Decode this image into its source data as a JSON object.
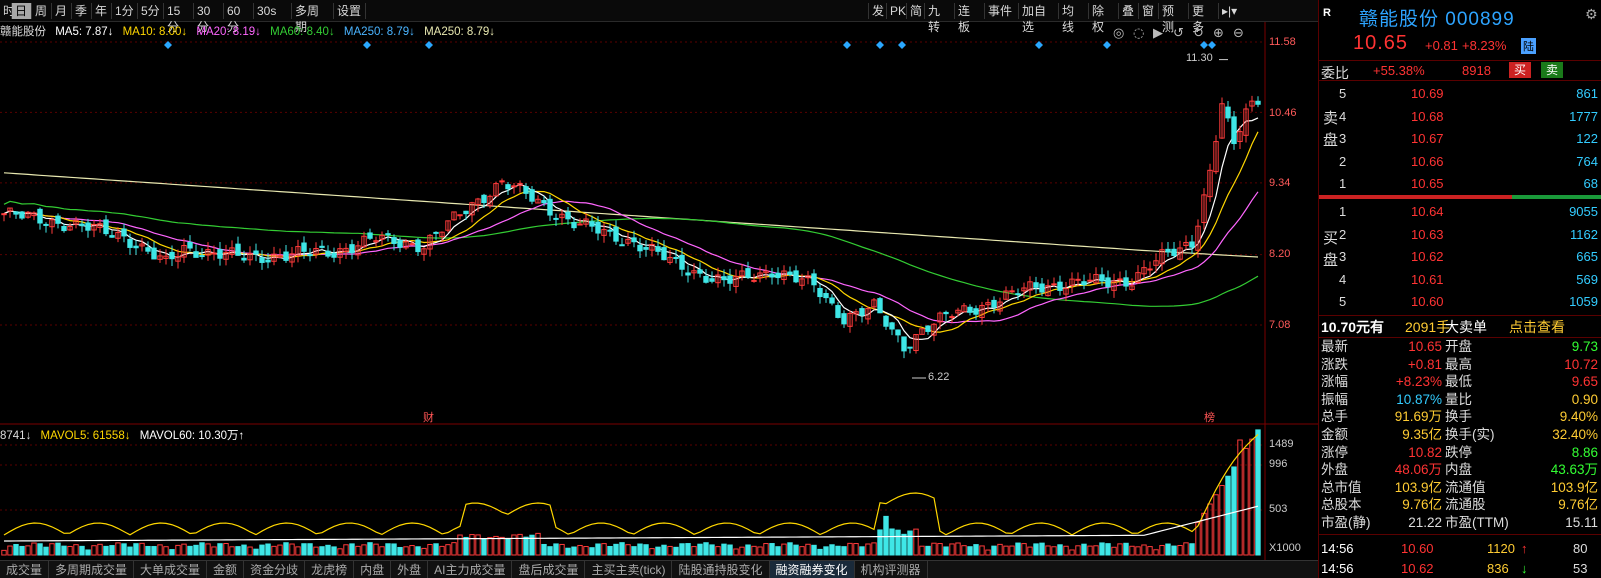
{
  "toolbar": {
    "left_items": [
      "时",
      "日",
      "周",
      "月",
      "季",
      "年",
      "1分",
      "5分",
      "15分",
      "30分",
      "60分",
      "30s",
      "多周期",
      "设置"
    ],
    "active_index": 1,
    "right_items": [
      "发",
      "PK",
      "简",
      "九转",
      "连板",
      "事件",
      "加自选",
      "均线",
      "除权",
      "叠",
      "窗",
      "预测",
      "更多"
    ]
  },
  "ma_line": {
    "stock_name": "赣能股份",
    "ma5": "MA5: 7.87↓",
    "ma10": "MA10: 8.00↓",
    "ma20": "MA20: 8.19↓",
    "ma60": "MA60: 8.40↓",
    "ma250_a": "MA250: 8.79↓",
    "ma250_b": "MA250: 8.79↓"
  },
  "vol_line": {
    "vol": "8741↓",
    "mavol5": "MAVOL5: 61558↓",
    "mavol60": "MAVOL60: 10.30万↑"
  },
  "price_axis": [
    "11.58",
    "10.46",
    "9.34",
    "8.20",
    "7.08"
  ],
  "vol_axis": [
    "1489",
    "996",
    "503",
    "X1000"
  ],
  "annotations": {
    "high": "11.30",
    "low": "6.22",
    "cai": "财",
    "bang": "榜"
  },
  "chart_data": {
    "type": "candlestick",
    "ylim": [
      6.2,
      11.58
    ],
    "price_ticks": [
      11.58,
      10.46,
      9.34,
      8.2,
      7.08
    ],
    "volume_ticks": [
      1489,
      996,
      503
    ],
    "volume_unit": "X1000",
    "series_names": [
      "MA5",
      "MA10",
      "MA20",
      "MA60",
      "MA250"
    ],
    "last_ma": {
      "MA5": 7.87,
      "MA10": 8.0,
      "MA20": 8.19,
      "MA60": 8.4,
      "MA250": 8.79
    },
    "period_high": 11.3,
    "period_low": 6.22
  },
  "colors": {
    "up": "#ff3b3b",
    "down": "#3fe6e6",
    "ma5": "#ffffff",
    "ma10": "#ffd700",
    "ma20": "#ff66ff",
    "ma60": "#33cc33",
    "ma250": "#e8e8b0",
    "accent_blue": "#2da4ff"
  },
  "right_panel": {
    "badge": "R",
    "stock": "赣能股份 000899",
    "price": "10.65",
    "change": "+0.81",
    "change_pct": "+8.23%",
    "market_tag": "陆",
    "webi_label": "委比",
    "webi_pct": "+55.38%",
    "webi_num": "8918",
    "buy_btn": "买",
    "sell_btn": "卖",
    "sell_side_label": "卖盘",
    "buy_side_label": "买盘",
    "asks": [
      {
        "lv": "5",
        "price": "10.69",
        "vol": "861"
      },
      {
        "lv": "4",
        "price": "10.68",
        "vol": "1777"
      },
      {
        "lv": "3",
        "price": "10.67",
        "vol": "122"
      },
      {
        "lv": "2",
        "price": "10.66",
        "vol": "764"
      },
      {
        "lv": "1",
        "price": "10.65",
        "vol": "68"
      }
    ],
    "bids": [
      {
        "lv": "1",
        "price": "10.64",
        "vol": "9055"
      },
      {
        "lv": "2",
        "price": "10.63",
        "vol": "1162"
      },
      {
        "lv": "3",
        "price": "10.62",
        "vol": "665"
      },
      {
        "lv": "4",
        "price": "10.61",
        "vol": "569"
      },
      {
        "lv": "5",
        "price": "10.60",
        "vol": "1059"
      }
    ],
    "dadan": {
      "price": "10.70元有",
      "vol": "2091手",
      "label": "大卖单",
      "action": "点击查看"
    },
    "stats": [
      {
        "k1": "最新",
        "v1": "10.65",
        "c1": "#ff3333",
        "k2": "开盘",
        "v2": "9.73",
        "c2": "#33ff33"
      },
      {
        "k1": "涨跌",
        "v1": "+0.81",
        "c1": "#ff3333",
        "k2": "最高",
        "v2": "10.72",
        "c2": "#ff3333"
      },
      {
        "k1": "涨幅",
        "v1": "+8.23%",
        "c1": "#ff3333",
        "k2": "最低",
        "v2": "9.65",
        "c2": "#ff3333"
      },
      {
        "k1": "振幅",
        "v1": "10.87%",
        "c1": "#33ccff",
        "k2": "量比",
        "v2": "0.90",
        "c2": "#ffcc33"
      },
      {
        "k1": "总手",
        "v1": "91.69万",
        "c1": "#ffcc33",
        "k2": "换手",
        "v2": "9.40%",
        "c2": "#ffcc33"
      },
      {
        "k1": "金额",
        "v1": "9.35亿",
        "c1": "#ffcc33",
        "k2": "换手(实)",
        "v2": "32.40%",
        "c2": "#ffcc33"
      },
      {
        "k1": "涨停",
        "v1": "10.82",
        "c1": "#ff3333",
        "k2": "跌停",
        "v2": "8.86",
        "c2": "#33ff33"
      },
      {
        "k1": "外盘",
        "v1": "48.06万",
        "c1": "#ff3333",
        "k2": "内盘",
        "v2": "43.63万",
        "c2": "#33ff33"
      },
      {
        "k1": "总市值",
        "v1": "103.9亿",
        "c1": "#ffcc33",
        "k2": "流通值",
        "v2": "103.9亿",
        "c2": "#ffcc33"
      },
      {
        "k1": "总股本",
        "v1": "9.76亿",
        "c1": "#ffcc33",
        "k2": "流通股",
        "v2": "9.76亿",
        "c2": "#ffcc33"
      },
      {
        "k1": "市盈(静)",
        "v1": "21.22",
        "c1": "#dddddd",
        "k2": "市盈(TTM)",
        "v2": "15.11",
        "c2": "#dddddd"
      }
    ],
    "ticks": [
      {
        "time": "14:56",
        "price": "10.60",
        "vol": "1120",
        "arrow": "↑",
        "n": "80"
      },
      {
        "time": "14:56",
        "price": "10.62",
        "vol": "836",
        "arrow": "↓",
        "n": "53"
      }
    ]
  },
  "bottom_tabs": [
    "成交量",
    "多周期成交量",
    "大单成交量",
    "金额",
    "资金分歧",
    "龙虎榜",
    "内盘",
    "外盘",
    "AI主力成交量",
    "盘后成交量",
    "主买主卖(tick)",
    "陆股通持股变化",
    "融资融券变化",
    "机构评测器"
  ],
  "bottom_active_index": 12
}
